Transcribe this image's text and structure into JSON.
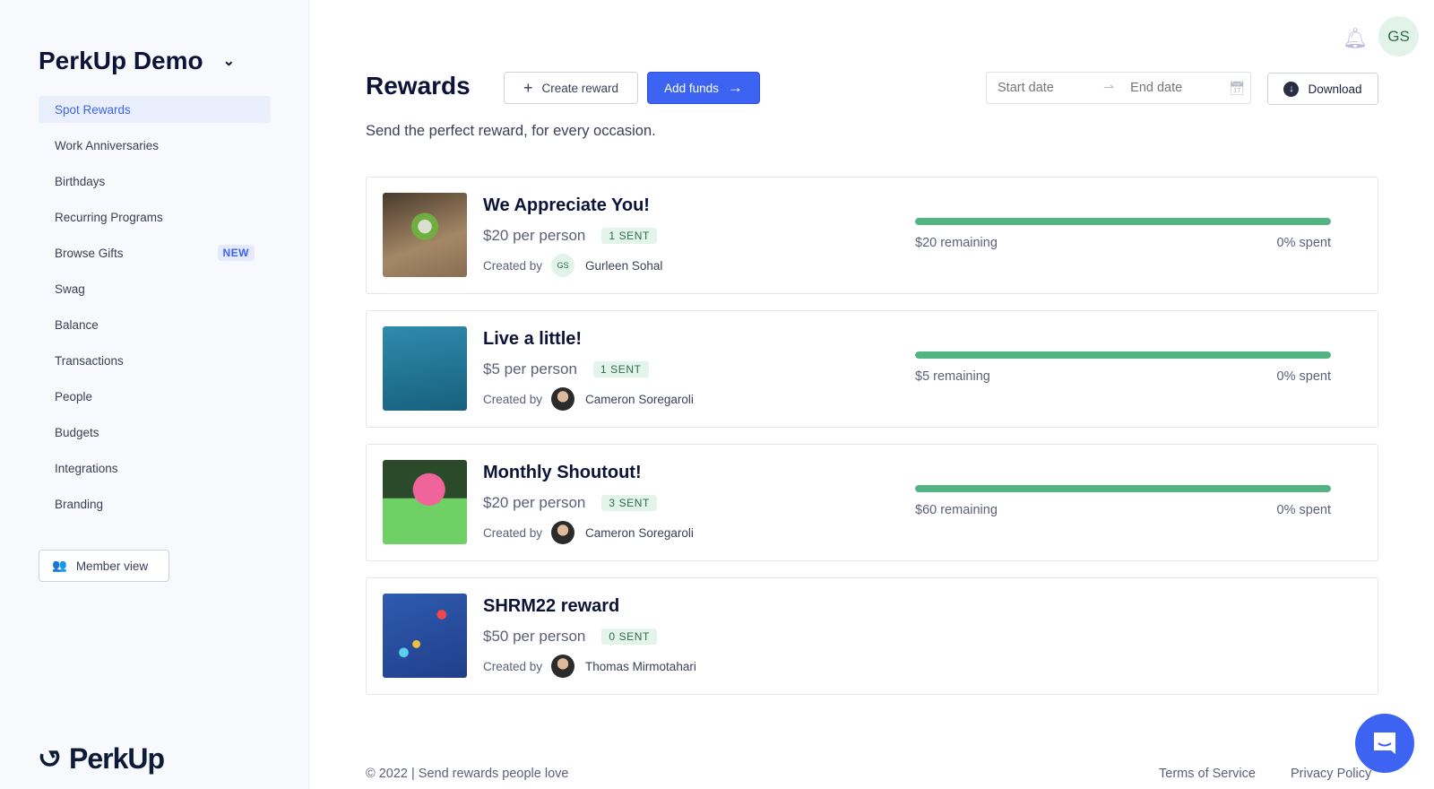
{
  "sidebar": {
    "org_name": "PerkUp Demo",
    "items": [
      {
        "label": "Spot Rewards",
        "active": true
      },
      {
        "label": "Work Anniversaries"
      },
      {
        "label": "Birthdays"
      },
      {
        "label": "Recurring Programs"
      },
      {
        "label": "Browse Gifts",
        "badge": "NEW"
      },
      {
        "label": "Swag"
      },
      {
        "label": "Balance"
      },
      {
        "label": "Transactions"
      },
      {
        "label": "People"
      },
      {
        "label": "Budgets"
      },
      {
        "label": "Integrations"
      },
      {
        "label": "Branding"
      }
    ],
    "member_view": "Member view",
    "logo": "PerkUp"
  },
  "header": {
    "title": "Rewards",
    "create_reward": "Create reward",
    "add_funds": "Add funds",
    "start_placeholder": "Start date",
    "end_placeholder": "End date",
    "download": "Download",
    "avatar_initials": "GS",
    "subtitle": "Send the perfect reward, for every occasion."
  },
  "colors": {
    "accent": "#3d63f2",
    "progress": "#52b383",
    "badge_bg": "#e3f4eb"
  },
  "rewards": [
    {
      "title": "We Appreciate You!",
      "price": "$20 per person",
      "sent": "1 SENT",
      "created_by_label": "Created by",
      "creator": "Gurleen Sohal",
      "creator_initials": "GS",
      "remaining": "$20 remaining",
      "spent": "0% spent",
      "spent_fraction": 0,
      "has_progress": true
    },
    {
      "title": "Live a little!",
      "price": "$5 per person",
      "sent": "1 SENT",
      "created_by_label": "Created by",
      "creator": "Cameron Soregaroli",
      "remaining": "$5 remaining",
      "spent": "0% spent",
      "spent_fraction": 0,
      "has_progress": true
    },
    {
      "title": "Monthly Shoutout!",
      "price": "$20 per person",
      "sent": "3 SENT",
      "created_by_label": "Created by",
      "creator": "Cameron Soregaroli",
      "remaining": "$60 remaining",
      "spent": "0% spent",
      "spent_fraction": 0,
      "has_progress": true
    },
    {
      "title": "SHRM22 reward",
      "price": "$50 per person",
      "sent": "0 SENT",
      "created_by_label": "Created by",
      "creator": "Thomas Mirmotahari",
      "has_progress": false
    }
  ],
  "footer": {
    "copyright": "© 2022 | Send rewards people love",
    "terms": "Terms of Service",
    "privacy": "Privacy Policy"
  }
}
